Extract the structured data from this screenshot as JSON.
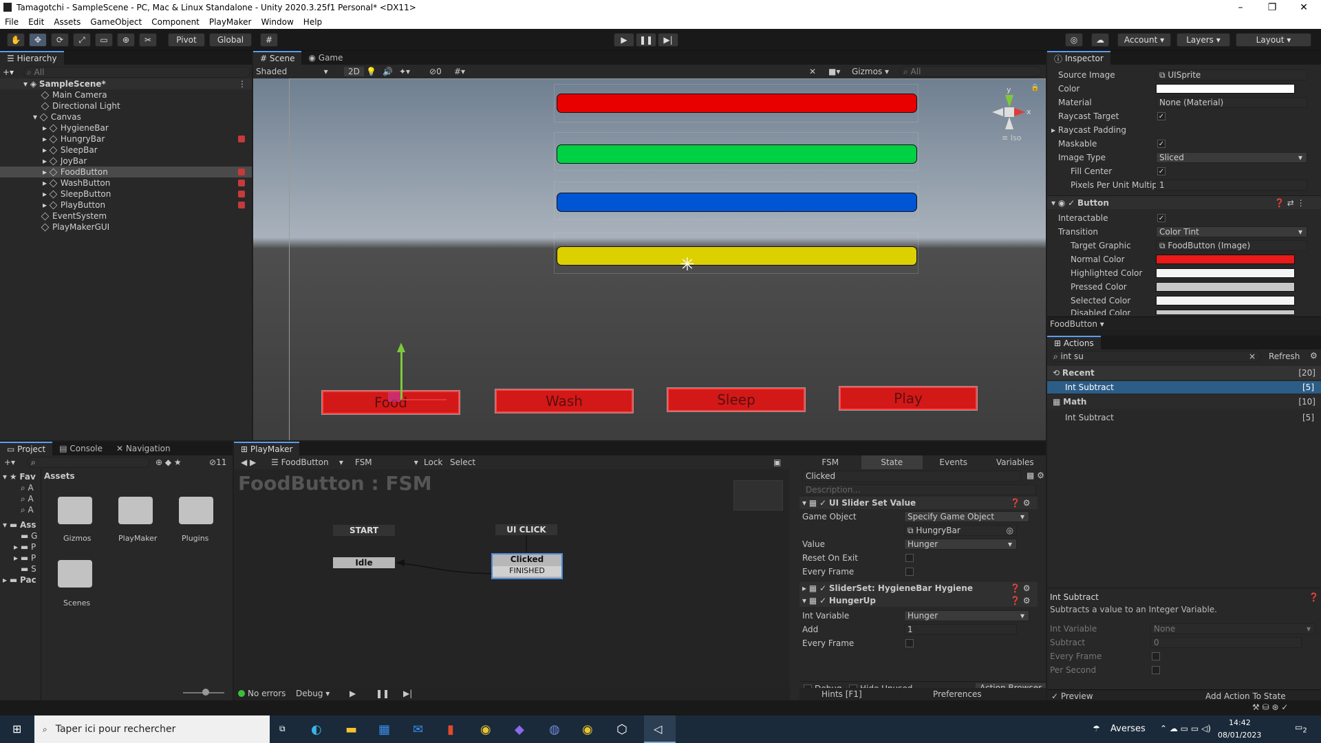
{
  "window": {
    "title": "Tamagotchi - SampleScene - PC, Mac & Linux Standalone - Unity 2020.3.25f1 Personal* <DX11>"
  },
  "menu": [
    "File",
    "Edit",
    "Assets",
    "GameObject",
    "Component",
    "PlayMaker",
    "Window",
    "Help"
  ],
  "toolbar": {
    "pivot": "Pivot",
    "global": "Global",
    "account": "Account",
    "layers": "Layers",
    "layout": "Layout"
  },
  "hierarchy": {
    "tab": "Hierarchy",
    "search_placeholder": "All",
    "scene": "SampleScene*",
    "items": [
      "Main Camera",
      "Directional Light",
      "Canvas",
      "HygieneBar",
      "HungryBar",
      "SleepBar",
      "JoyBar",
      "FoodButton",
      "WashButton",
      "SleepButton",
      "PlayButton",
      "EventSystem",
      "PlayMakerGUI"
    ]
  },
  "scene": {
    "tabs": [
      "Scene",
      "Game"
    ],
    "shading": "Shaded",
    "mode2d": "2D",
    "gizmos": "Gizmos",
    "search_placeholder": "All",
    "iso": "Iso",
    "counter": "0",
    "axis_y": "y",
    "axis_x": "x",
    "buttons": [
      "Food",
      "Wash",
      "Sleep",
      "Play"
    ],
    "bar_colors": [
      "#e80000",
      "#00d044",
      "#0055d4",
      "#ddd000"
    ]
  },
  "inspector": {
    "tab": "Inspector",
    "rows": [
      {
        "label": "Source Image",
        "value": "UISprite"
      },
      {
        "label": "Color",
        "value": ""
      },
      {
        "label": "Material",
        "value": "None (Material)"
      },
      {
        "label": "Raycast Target",
        "value": "✓"
      },
      {
        "label": "Raycast Padding",
        "value": ""
      },
      {
        "label": "Maskable",
        "value": "✓"
      },
      {
        "label": "Image Type",
        "value": "Sliced"
      },
      {
        "label": "Fill Center",
        "value": "✓"
      },
      {
        "label": "Pixels Per Unit Multipli",
        "value": "1"
      }
    ],
    "button_component": "Button",
    "button_rows": [
      {
        "label": "Interactable",
        "value": "✓"
      },
      {
        "label": "Transition",
        "value": "Color Tint"
      },
      {
        "label": "Target Graphic",
        "value": "FoodButton (Image)"
      },
      {
        "label": "Normal Color",
        "value": ""
      },
      {
        "label": "Highlighted Color",
        "value": ""
      },
      {
        "label": "Pressed Color",
        "value": ""
      },
      {
        "label": "Selected Color",
        "value": ""
      },
      {
        "label": "Disabled Color",
        "value": ""
      }
    ],
    "foodbutton": "FoodButton"
  },
  "actions": {
    "tab": "Actions",
    "search": "int su",
    "refresh": "Refresh",
    "recent": "Recent",
    "recent_count": "[20]",
    "item1": "Int Subtract",
    "item1_count": "[5]",
    "math": "Math",
    "math_count": "[10]",
    "item2": "Int Subtract",
    "item2_count": "[5]",
    "desc_title": "Int Subtract",
    "desc": "Subtracts a value to an Integer Variable.",
    "params": [
      {
        "label": "Int Variable",
        "value": "None"
      },
      {
        "label": "Subtract",
        "value": "0"
      },
      {
        "label": "Every Frame",
        "value": ""
      },
      {
        "label": "Per Second",
        "value": ""
      }
    ],
    "preview": "Preview",
    "add": "Add Action To State"
  },
  "project": {
    "tabs": [
      "Project",
      "Console",
      "Navigation"
    ],
    "assets_label": "Assets",
    "hidden_count": "11",
    "fav": "Fav",
    "ass": "Ass",
    "pac": "Pac",
    "folders": [
      "Gizmos",
      "PlayMaker",
      "Plugins",
      "Scenes"
    ]
  },
  "playmaker": {
    "tab": "PlayMaker",
    "object": "FoodButton",
    "fsm": "FSM",
    "lock": "Lock",
    "select": "Select",
    "title": "FoodButton : FSM",
    "start": "START",
    "idle": "Idle",
    "uiclick": "UI CLICK",
    "clicked": "Clicked",
    "finished": "FINISHED",
    "status": "No errors",
    "debug": "Debug",
    "tabs": [
      "FSM",
      "State",
      "Events",
      "Variables"
    ],
    "state_name": "Clicked",
    "desc_placeholder": "Description...",
    "action1": "UI Slider Set Value",
    "a1_rows": [
      {
        "label": "Game Object",
        "value": "Specify Game Object"
      },
      {
        "label": "",
        "value": "HungryBar"
      },
      {
        "label": "Value",
        "value": "Hunger"
      },
      {
        "label": "Reset On Exit",
        "value": ""
      },
      {
        "label": "Every Frame",
        "value": ""
      }
    ],
    "action2": "SliderSet: HygieneBar  Hygiene",
    "action3": "HungerUp",
    "a3_rows": [
      {
        "label": "Int Variable",
        "value": "Hunger"
      },
      {
        "label": "Add",
        "value": "1"
      },
      {
        "label": "Every Frame",
        "value": ""
      }
    ],
    "debug_label": "Debug",
    "hide_unused": "Hide Unused",
    "action_browser": "Action Browser",
    "hints": "Hints [F1]",
    "preferences": "Preferences"
  },
  "taskbar": {
    "search": "Taper ici pour rechercher",
    "weather": "Averses",
    "time": "14:42",
    "date": "08/01/2023",
    "notif": "2"
  }
}
